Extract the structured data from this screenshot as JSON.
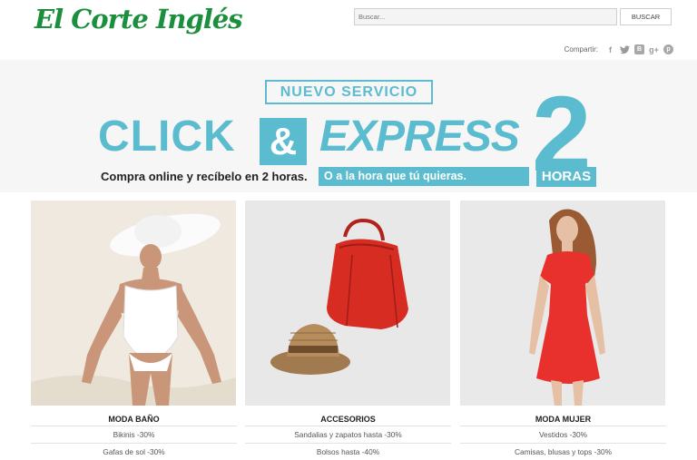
{
  "brand": {
    "logo_text": "El Corte Inglés",
    "logo_color": "#1a8f3c"
  },
  "search": {
    "placeholder": "Buscar...",
    "button_label": "BUSCAR"
  },
  "share": {
    "label": "Compartir:",
    "icons": [
      "facebook-icon",
      "twitter-icon",
      "blog-icon",
      "google-plus-icon",
      "pinterest-icon"
    ]
  },
  "banner": {
    "badge": "NUEVO SERVICIO",
    "word_click": "CLICK",
    "ampersand": "&",
    "word_express": "EXPRESS",
    "big_number": "2",
    "hours_label": "HORAS",
    "tagline": "Compra online y recíbelo en 2 horas.",
    "tagline_highlight": "O a la hora que tú quieras.",
    "accent_color": "#5bbccf"
  },
  "products": [
    {
      "title": "MODA BAÑO",
      "links": [
        "Bikinis -30%",
        "Gafas de sol -30%"
      ]
    },
    {
      "title": "ACCESORIOS",
      "links": [
        "Sandalias y zapatos hasta -30%",
        "Bolsos hasta -40%"
      ]
    },
    {
      "title": "MODA MUJER",
      "links": [
        "Vestidos -30%",
        "Camisas, blusas y tops -30%"
      ]
    }
  ]
}
